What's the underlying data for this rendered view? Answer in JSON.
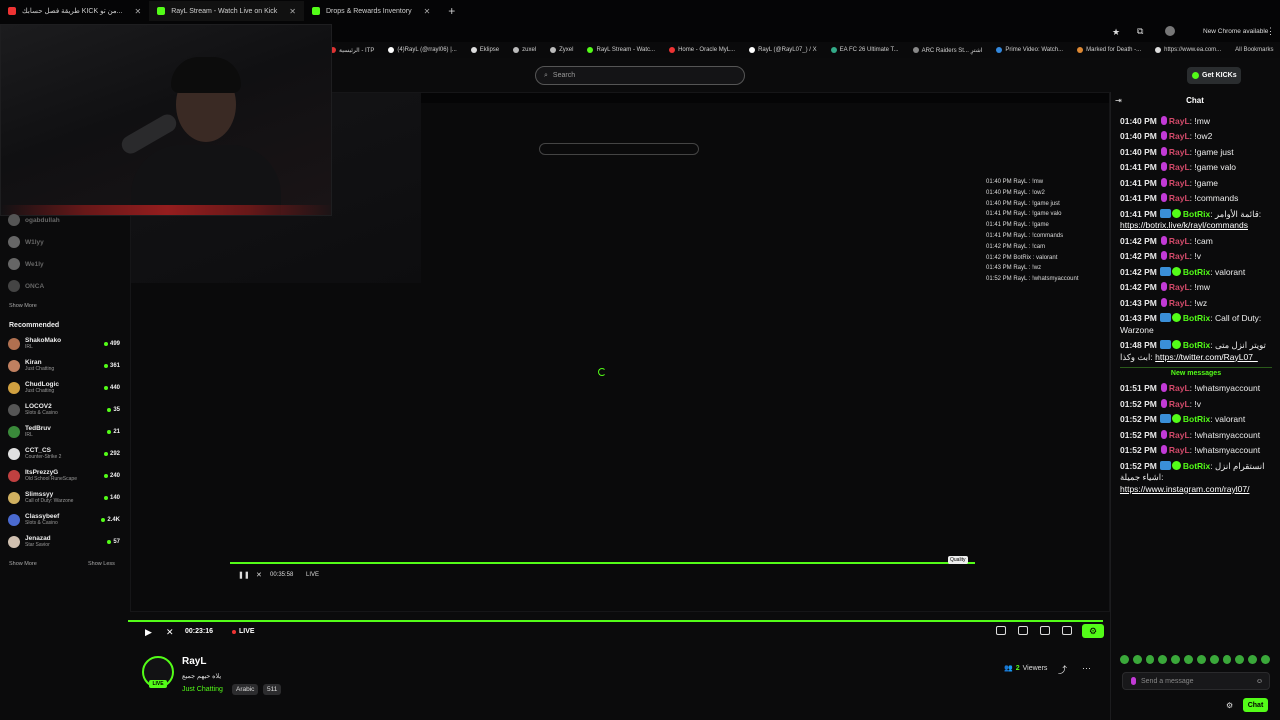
{
  "browser": {
    "tabs": [
      {
        "label": "طريقة فصل حسابك KICK من تو...",
        "color": "#e33"
      },
      {
        "label": "RayL Stream - Watch Live on Kick",
        "color": "#53fc18"
      },
      {
        "label": "Drops & Rewards Inventory",
        "color": "#53fc18"
      }
    ],
    "new_chrome": "New Chrome available",
    "bookmarks": [
      "الرئيسية - ITP",
      "(4)RayL (@rrayl06) |...",
      "Eklipse",
      "zuxel",
      "Zyxel",
      "RayL Stream - Watc...",
      "Home - Oracle MyL...",
      "RayL (@RayL07_) / X",
      "EA FC 26 Ultimate T...",
      "ARC Raiders St... اشترِ",
      "Prime Video: Watch...",
      "Marked for Death -...",
      "https://www.ea.com..."
    ],
    "all_bookmarks": "All Bookmarks"
  },
  "header": {
    "search_placeholder": "Search",
    "get_kicks": "Get KICKs"
  },
  "sidebar": {
    "following": [
      {
        "name": "ogabdullah",
        "color": "#555"
      },
      {
        "name": "W1lyy",
        "color": "#666"
      },
      {
        "name": "We1ly",
        "color": "#666"
      },
      {
        "name": "ONCA",
        "color": "#444"
      }
    ],
    "show_more_top": "Show More",
    "recommended_title": "Recommended",
    "recommended": [
      {
        "name": "ShakoMako",
        "cat": "IRL",
        "viewers": "499",
        "color": "#b07050"
      },
      {
        "name": "Kiran",
        "cat": "Just Chatting",
        "viewers": "361",
        "color": "#c08060"
      },
      {
        "name": "ChudLogic",
        "cat": "Just Chatting",
        "viewers": "440",
        "color": "#d0a040"
      },
      {
        "name": "LOCOV2",
        "cat": "Slots & Casino",
        "viewers": "35",
        "color": "#555"
      },
      {
        "name": "TedBruv",
        "cat": "IRL",
        "viewers": "21",
        "color": "#3a8a3a"
      },
      {
        "name": "CCT_CS",
        "cat": "Counter-Strike 2",
        "viewers": "292",
        "color": "#e0e0e0"
      },
      {
        "name": "ItsPrezzyG",
        "cat": "Old School RuneScape",
        "viewers": "240",
        "color": "#c04040"
      },
      {
        "name": "Slimssyy",
        "cat": "Call of Duty: Warzone",
        "viewers": "140",
        "color": "#d0b060"
      },
      {
        "name": "Classybeef",
        "cat": "Slots & Casino",
        "viewers": "2.4K",
        "color": "#4a6ad0"
      },
      {
        "name": "Jenazad",
        "cat": "Star Savior",
        "viewers": "57",
        "color": "#d0c0b0"
      }
    ],
    "show_more": "Show More",
    "show_less": "Show Less"
  },
  "player": {
    "nested_time": "00:35:58",
    "nested_live": "LIVE",
    "time": "00:23:16",
    "live": "LIVE",
    "quality_tooltip": "Quality"
  },
  "channel": {
    "name": "RayL",
    "title": "يلاه حيهم جميع",
    "category": "Just Chatting",
    "tags": [
      "Arabic",
      "511"
    ],
    "live_badge": "LIVE",
    "viewers_count": "2",
    "viewers_label": "Viewers"
  },
  "chat": {
    "title": "Chat",
    "new_messages": "New messages",
    "messages": [
      {
        "time": "01:40 PM",
        "user": "RayL",
        "text": "!mw"
      },
      {
        "time": "01:40 PM",
        "user": "RayL",
        "text": "!ow2"
      },
      {
        "time": "01:40 PM",
        "user": "RayL",
        "text": "!game just"
      },
      {
        "time": "01:41 PM",
        "user": "RayL",
        "text": "!game valo"
      },
      {
        "time": "01:41 PM",
        "user": "RayL",
        "text": "!game"
      },
      {
        "time": "01:41 PM",
        "user": "RayL",
        "text": "!commands"
      },
      {
        "time": "01:41 PM",
        "user": "BotRix",
        "text": "قائمة الأوامر:",
        "link": "https://botrix.live/k/rayl/commands"
      },
      {
        "time": "01:42 PM",
        "user": "RayL",
        "text": "!cam"
      },
      {
        "time": "01:42 PM",
        "user": "RayL",
        "text": "!v"
      },
      {
        "time": "01:42 PM",
        "user": "BotRix",
        "text": "valorant"
      },
      {
        "time": "01:42 PM",
        "user": "RayL",
        "text": "!mw"
      },
      {
        "time": "01:43 PM",
        "user": "RayL",
        "text": "!wz"
      },
      {
        "time": "01:43 PM",
        "user": "BotRix",
        "text": "Call of Duty: Warzone"
      },
      {
        "time": "01:48 PM",
        "user": "BotRix",
        "text": "تويتر انزل متى ابث وكذا:",
        "link": "https://twitter.com/RayL07_"
      }
    ],
    "messages_after": [
      {
        "time": "01:51 PM",
        "user": "RayL",
        "text": "!whatsmyaccount"
      },
      {
        "time": "01:52 PM",
        "user": "RayL",
        "text": "!v"
      },
      {
        "time": "01:52 PM",
        "user": "BotRix",
        "text": "valorant"
      },
      {
        "time": "01:52 PM",
        "user": "RayL",
        "text": "!whatsmyaccount"
      },
      {
        "time": "01:52 PM",
        "user": "RayL",
        "text": "!whatsmyaccount"
      },
      {
        "time": "01:52 PM",
        "user": "BotRix",
        "text": "انستقرام انزل اشياء جميلة:",
        "link": "https://www.instagram.com/rayl07/"
      }
    ],
    "input_placeholder": "Send a message",
    "send_label": "Chat"
  },
  "colors": {
    "accent": "#53fc18",
    "rayl": "#d24a6a",
    "background": "#0b0b0c"
  }
}
